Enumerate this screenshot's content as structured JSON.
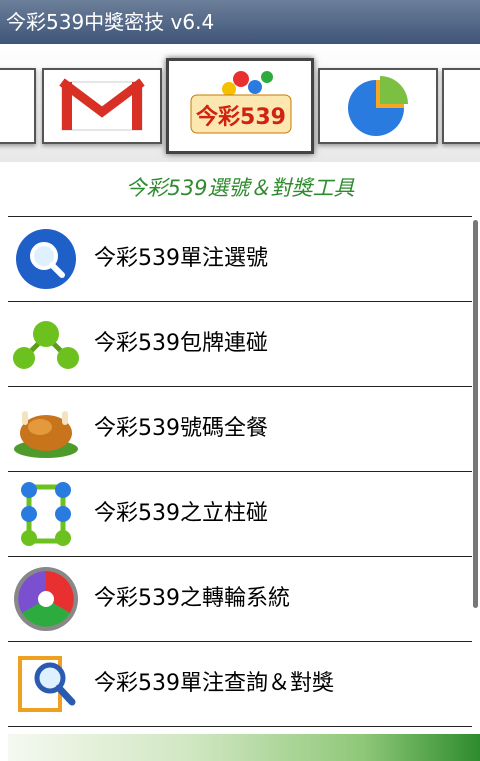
{
  "app": {
    "title": "今彩539中獎密技 v6.4"
  },
  "gallery": {
    "items": [
      "gmail-icon",
      "lottery-539-logo-icon",
      "pie-chart-icon"
    ],
    "selected_logo_text": "今彩539"
  },
  "section_title": "今彩539選號＆對獎工具",
  "menu": {
    "items": [
      {
        "label": "今彩539單注選號",
        "icon": "magnifier-blue-icon"
      },
      {
        "label": "今彩539包牌連碰",
        "icon": "green-molecule-icon"
      },
      {
        "label": "今彩539號碼全餐",
        "icon": "roast-turkey-icon"
      },
      {
        "label": "今彩539之立柱碰",
        "icon": "dots-grid-icon"
      },
      {
        "label": "今彩539之轉輪系統",
        "icon": "picasa-wheel-icon"
      },
      {
        "label": "今彩539單注查詢＆對獎",
        "icon": "document-search-icon"
      }
    ]
  },
  "colors": {
    "titlebar": "#3f5578",
    "section_title": "#2e8b2e"
  }
}
